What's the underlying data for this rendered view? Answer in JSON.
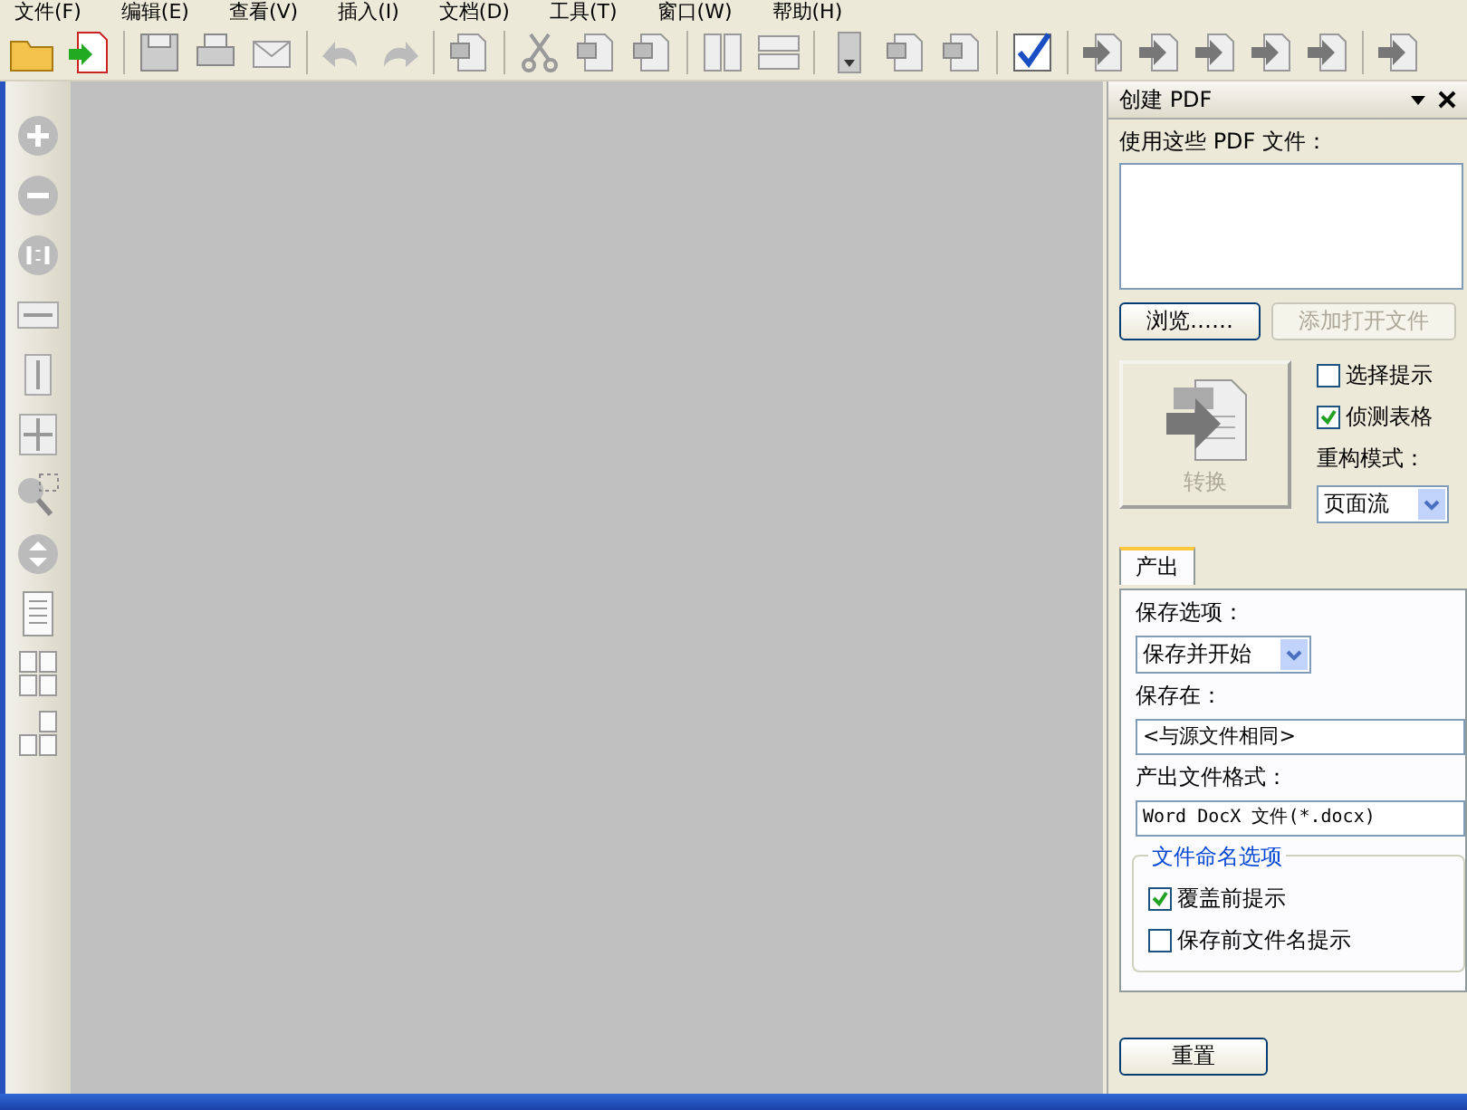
{
  "menu": [
    "文件(F)",
    "编辑(E)",
    "查看(V)",
    "插入(I)",
    "文档(D)",
    "工具(T)",
    "窗口(W)",
    "帮助(H)"
  ],
  "panel": {
    "title": "创建 PDF",
    "files_label": "使用这些 PDF 文件：",
    "browse_button": {
      "label": "浏览……",
      "disabled": false
    },
    "add_open_button": {
      "label": "添加打开文件",
      "disabled": true
    },
    "convert_button": {
      "label": "转换",
      "disabled": true
    },
    "options": [
      {
        "label": "选择提示",
        "checked": false
      },
      {
        "label": "侦测表格",
        "checked": true
      }
    ],
    "mode_label": "重构模式：",
    "mode_value": "页面流",
    "tabs": [
      {
        "label": "产出",
        "selected": true
      }
    ],
    "save_option_label": "保存选项：",
    "save_option_value": "保存并开始",
    "save_in_label": "保存在：",
    "save_in_value": "<与源文件相同>",
    "format_label": "产出文件格式：",
    "format_value": "Word DocX 文件(*.docx)",
    "naming_group": {
      "title": "文件命名选项",
      "options": [
        {
          "label": "覆盖前提示",
          "checked": true
        },
        {
          "label": "保存前文件名提示",
          "checked": false
        }
      ]
    },
    "reset_button": {
      "label": "重置",
      "disabled": false
    }
  }
}
